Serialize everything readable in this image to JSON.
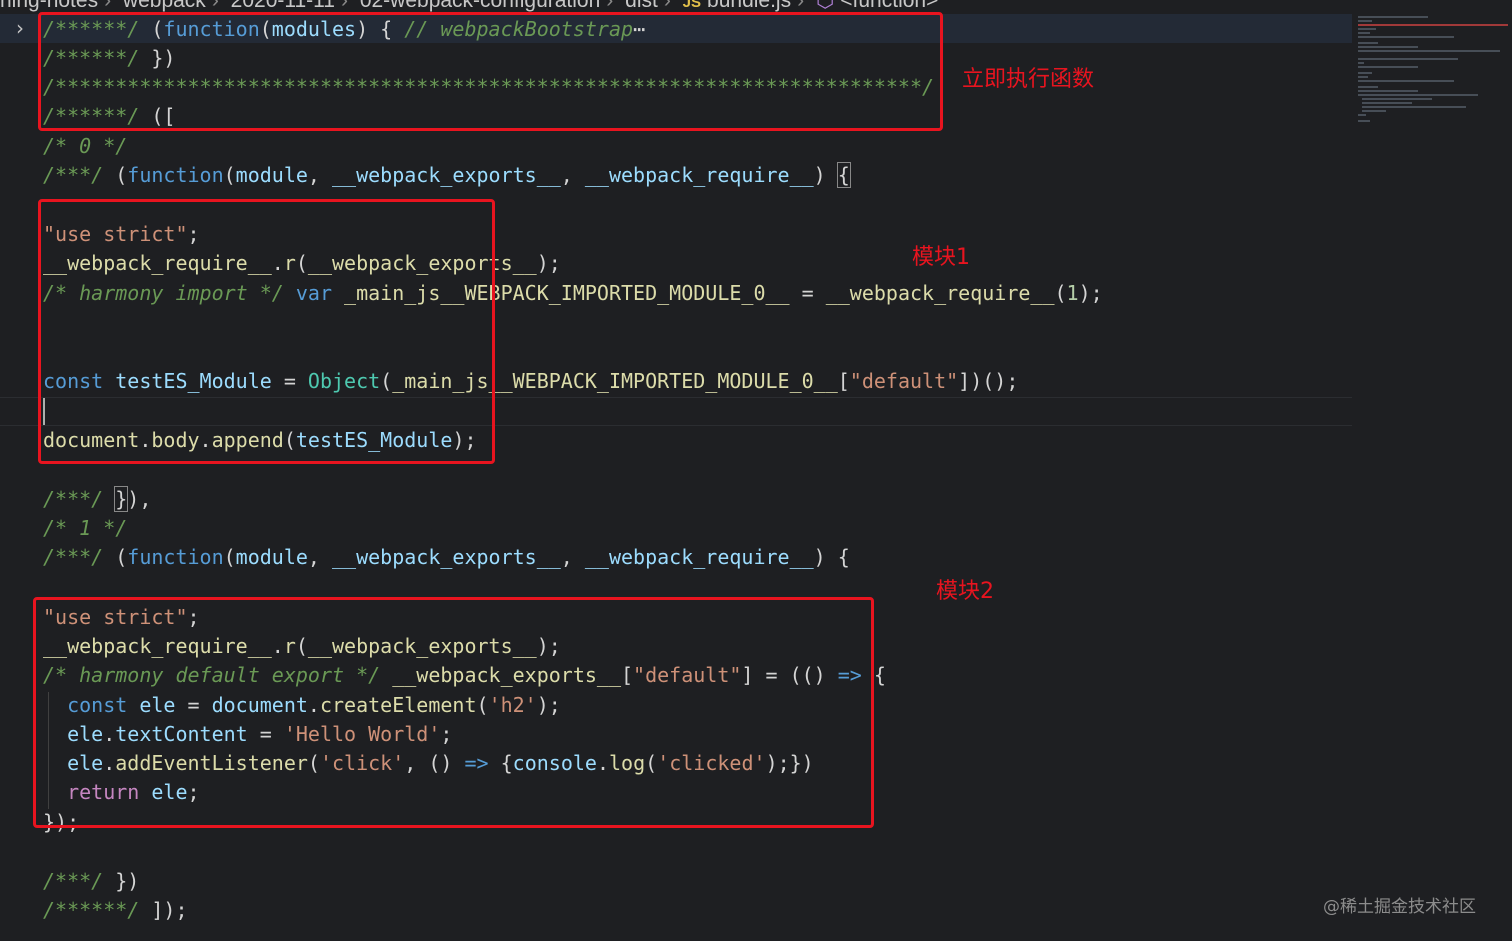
{
  "breadcrumb": {
    "items": [
      "ning-notes",
      "webpack",
      "2020-11-11",
      "02-webpack-configuration",
      "dist"
    ],
    "file": {
      "badge": "JS",
      "name": "bundle.js"
    },
    "symbol": "<function>"
  },
  "code": {
    "l1": [
      "/******/ ",
      "(",
      "function",
      "(",
      "modules",
      ") { ",
      "// webpackBootstrap",
      "⋯"
    ],
    "l2": [
      "/******/ ",
      "})"
    ],
    "l3": [
      "/************************************************************************/"
    ],
    "l4": [
      "/******/ ",
      "(["
    ],
    "l5": [
      "/* 0 */"
    ],
    "l6": [
      "/***/ ",
      "(",
      "function",
      "(",
      "module",
      ", ",
      "__webpack_exports__",
      ", ",
      "__webpack_require__",
      ") ",
      "{"
    ],
    "l7": [],
    "l8": [
      "\"use strict\"",
      ";"
    ],
    "l9": [
      "__webpack_require__",
      ".",
      "r",
      "(",
      "__webpack_exports__",
      ");"
    ],
    "l10": [
      "/* harmony import */ ",
      "var ",
      "_main_js__WEBPACK_IMPORTED_MODULE_0__",
      " = ",
      "__webpack_require__",
      "(",
      "1",
      ");"
    ],
    "l11": [],
    "l12": [],
    "l13": [
      "const ",
      "testES_Module",
      " = ",
      "Object",
      "(",
      "_main_js__WEBPACK_IMPORTED_MODULE_0__",
      "[",
      "\"default\"",
      "])();"
    ],
    "l14": [],
    "l15": [
      "document",
      ".",
      "body",
      ".",
      "append",
      "(",
      "testES_Module",
      ");"
    ],
    "l16": [],
    "l17": [
      "/***/ ",
      "}",
      "),"
    ],
    "l18": [
      "/* 1 */"
    ],
    "l19": [
      "/***/ ",
      "(",
      "function",
      "(",
      "module",
      ", ",
      "__webpack_exports__",
      ", ",
      "__webpack_require__",
      ") {"
    ],
    "l20": [],
    "l21": [
      "\"use strict\"",
      ";"
    ],
    "l22": [
      "__webpack_require__",
      ".",
      "r",
      "(",
      "__webpack_exports__",
      ");"
    ],
    "l23": [
      "/* harmony default export */ ",
      "__webpack_exports__",
      "[",
      "\"default\"",
      "] = (() ",
      "=>",
      " {"
    ],
    "l24": [
      "  ",
      "const ",
      "ele",
      " = ",
      "document",
      ".",
      "createElement",
      "(",
      "'h2'",
      ");"
    ],
    "l25": [
      "  ",
      "ele",
      ".",
      "textContent",
      " = ",
      "'Hello World'",
      ";"
    ],
    "l26": [
      "  ",
      "ele",
      ".",
      "addEventListener",
      "(",
      "'click'",
      ", () ",
      "=>",
      " {",
      "console",
      ".",
      "log",
      "(",
      "'clicked'",
      ");})"
    ],
    "l27": [
      "  ",
      "return ",
      "ele",
      ";"
    ],
    "l28": [
      "});"
    ],
    "l29": [],
    "l30": [
      "/***/ ",
      "})"
    ],
    "l31": [
      "/******/ ",
      "]);"
    ]
  },
  "annotations": {
    "iife_label": "立即执行函数",
    "module1_label": "模块1",
    "module2_label": "模块2"
  },
  "colors": {
    "annotation": "#e8141f",
    "background": "#1e1f22",
    "comment": "#6a9955",
    "string": "#ce9178",
    "keyword": "#569cd6",
    "function": "#dcdcaa",
    "variable": "#9cdcfe"
  },
  "watermark": "@稀土掘金技术社区"
}
